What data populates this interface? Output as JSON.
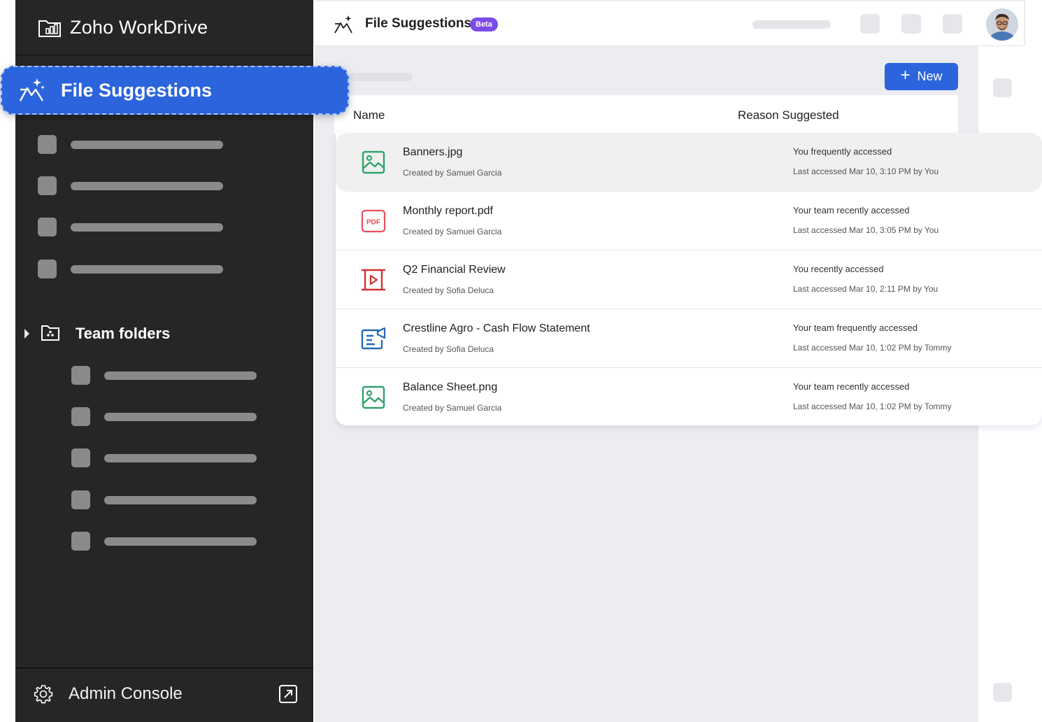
{
  "app": {
    "name": "Zoho WorkDrive"
  },
  "sidebar": {
    "selected_label": "File Suggestions",
    "team_folders_label": "Team folders",
    "admin_label": "Admin Console"
  },
  "topbar": {
    "title": "File Suggestions",
    "badge": "Beta"
  },
  "toolbar": {
    "new_label": "New"
  },
  "table": {
    "col_name": "Name",
    "col_reason": "Reason Suggested",
    "rows": [
      {
        "name": "Banners.jpg",
        "created": "Created by Samuel Garcia",
        "reason": "You frequently accessed",
        "access": "Last accessed Mar 10, 3:10 PM by You",
        "icon": "image-file-icon"
      },
      {
        "name": "Monthly report.pdf",
        "created": "Created by Samuel Garcia",
        "reason": "Your team recently accessed",
        "access": "Last accessed Mar 10, 3:05 PM by You",
        "icon": "pdf-file-icon"
      },
      {
        "name": "Q2 Financial Review",
        "created": "Created by Sofia Deluca",
        "reason": "You recently accessed",
        "access": "Last accessed Mar 10, 2:11 PM by You",
        "icon": "presentation-file-icon"
      },
      {
        "name": "Crestline Agro - Cash Flow Statement",
        "created": "Created by Sofia Deluca",
        "reason": "Your team frequently accessed",
        "access": "Last accessed Mar 10, 1:02 PM by Tommy",
        "icon": "document-file-icon"
      },
      {
        "name": "Balance Sheet.png",
        "created": "Created by Samuel Garcia",
        "reason": "Your team recently accessed",
        "access": "Last accessed Mar 10, 1:02 PM by Tommy",
        "icon": "image-file-icon"
      }
    ]
  },
  "colors": {
    "accent": "#2b64dc",
    "sidebar_bg": "#262626",
    "beta_badge": "#7a4be6",
    "image_icon": "#2fa36b",
    "pdf_icon": "#e8505b",
    "presentation_icon": "#d32f2f",
    "document_icon": "#2469b3"
  }
}
